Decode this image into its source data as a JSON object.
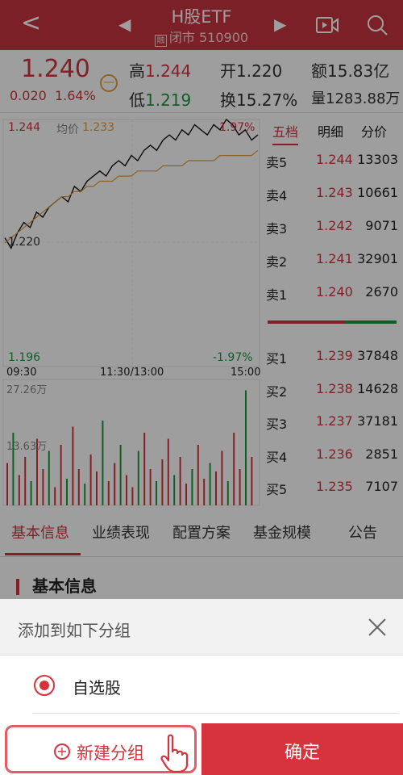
{
  "header": {
    "title": "H股ETF",
    "tag_icon": "融",
    "status": "闭市 510900"
  },
  "quote": {
    "price": "1.240",
    "change": "0.020",
    "change_pct": "1.64%",
    "high_label": "高",
    "high": "1.244",
    "low_label": "低",
    "low": "1.219",
    "open_label": "开",
    "open": "1.220",
    "turnover_label": "换",
    "turnover": "15.27%",
    "amount_label": "额",
    "amount": "15.83亿",
    "volume_label": "量",
    "volume": "1283.88万"
  },
  "chart": {
    "top_price": "1.244",
    "avg_label": "均价",
    "avg_value": "1.233",
    "top_pct": "1.97%",
    "ref_price": "1.220",
    "bottom_price": "1.196",
    "bottom_pct": "-1.97%",
    "time_start": "09:30",
    "time_mid": "11:30/13:00",
    "time_end": "15:00",
    "vol_max": "27.26万",
    "vol_mid": "13.63万"
  },
  "chart_data": {
    "type": "line",
    "title": "",
    "xlabel": "",
    "ylabel": "",
    "x_ticks": [
      "09:30",
      "11:30/13:00",
      "15:00"
    ],
    "ylim": [
      1.196,
      1.244
    ],
    "series": [
      {
        "name": "",
        "values": [
          1.221,
          1.219,
          1.222,
          1.224,
          1.223,
          1.226,
          1.225,
          1.227,
          1.228,
          1.229,
          1.228,
          1.231,
          1.23,
          1.232,
          1.233,
          1.234,
          1.233,
          1.235,
          1.236,
          1.235,
          1.237,
          1.236,
          1.238,
          1.239,
          1.238,
          1.24,
          1.241,
          1.24,
          1.242,
          1.241,
          1.243,
          1.242,
          1.241,
          1.243,
          1.242,
          1.244,
          1.243,
          1.241,
          1.242,
          1.24,
          1.241
        ]
      },
      {
        "name": "均价",
        "values": [
          1.22,
          1.221,
          1.222,
          1.223,
          1.224,
          1.225,
          1.226,
          1.227,
          1.228,
          1.229,
          1.229,
          1.23,
          1.23,
          1.231,
          1.231,
          1.232,
          1.232,
          1.232,
          1.233,
          1.233,
          1.233,
          1.234,
          1.234,
          1.234,
          1.234,
          1.235,
          1.235,
          1.235,
          1.235,
          1.236,
          1.236,
          1.236,
          1.236,
          1.236,
          1.237,
          1.237,
          1.237,
          1.237,
          1.237,
          1.237,
          1.238
        ]
      }
    ]
  },
  "orderbook": {
    "tabs": [
      "五档",
      "明细",
      "分价"
    ],
    "asks": [
      {
        "label": "卖5",
        "price": "1.244",
        "vol": "13303"
      },
      {
        "label": "卖4",
        "price": "1.243",
        "vol": "10661"
      },
      {
        "label": "卖3",
        "price": "1.242",
        "vol": "9071"
      },
      {
        "label": "卖2",
        "price": "1.241",
        "vol": "32901"
      },
      {
        "label": "卖1",
        "price": "1.240",
        "vol": "2670"
      }
    ],
    "bids": [
      {
        "label": "买1",
        "price": "1.239",
        "vol": "37848"
      },
      {
        "label": "买2",
        "price": "1.238",
        "vol": "14628"
      },
      {
        "label": "买3",
        "price": "1.237",
        "vol": "37181"
      },
      {
        "label": "买4",
        "price": "1.236",
        "vol": "2851"
      },
      {
        "label": "买5",
        "price": "1.235",
        "vol": "7107"
      }
    ]
  },
  "info_tabs": [
    "基本信息",
    "业绩表现",
    "配置方案",
    "基金规模",
    "公告"
  ],
  "section_title": "基本信息",
  "sheet": {
    "title": "添加到如下分组",
    "option": "自选股",
    "new_group": "新建分组",
    "confirm": "确定"
  },
  "colors": {
    "brand": "#c8343f",
    "up": "#d6333d",
    "down": "#1e9a3c",
    "avg": "#e2a13d"
  }
}
